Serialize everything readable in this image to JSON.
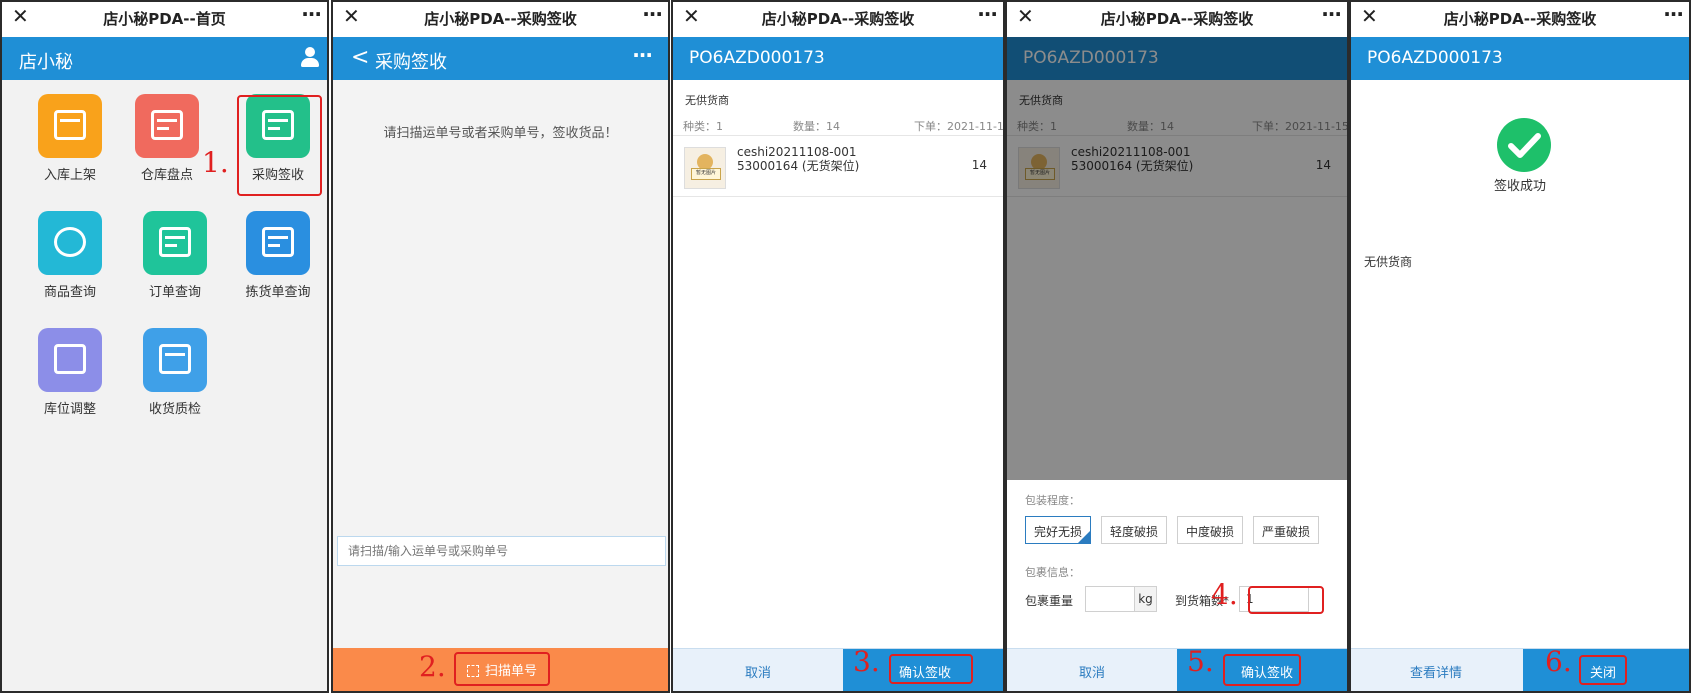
{
  "colors": {
    "brand_blue": "#1f8fd6",
    "annotation_red": "#e02020",
    "scan_orange": "#fa8a4a",
    "success_green": "#1ec06a"
  },
  "window": {
    "close_glyph": "✕",
    "more_glyph": "···"
  },
  "panel1": {
    "title": "店小秘PDA--首页",
    "header": "店小秘",
    "tiles": [
      {
        "label": "入库上架",
        "icon": "shelf-upload-icon",
        "color": "#f9a21b"
      },
      {
        "label": "仓库盘点",
        "icon": "inventory-calculator-icon",
        "color": "#f06a5e"
      },
      {
        "label": "采购签收",
        "icon": "purchase-receive-icon",
        "color": "#23c08a"
      },
      {
        "label": "商品查询",
        "icon": "product-search-icon",
        "color": "#23b8d6"
      },
      {
        "label": "订单查询",
        "icon": "order-query-icon",
        "color": "#1fc49a"
      },
      {
        "label": "拣货单查询",
        "icon": "pick-list-icon",
        "color": "#2a8fe0"
      },
      {
        "label": "库位调整",
        "icon": "location-adjust-icon",
        "color": "#8c8ee8"
      },
      {
        "label": "收货质检",
        "icon": "quality-check-icon",
        "color": "#3fa0e8"
      }
    ],
    "step_mark": "1."
  },
  "panel2": {
    "title": "店小秘PDA--采购签收",
    "header": "采购签收",
    "back_glyph": "<",
    "more_glyph": "···",
    "hint": "请扫描运单号或者采购单号，签收货品！",
    "input_placeholder": "请扫描/输入运单号或采购单号",
    "scan_button": "扫描单号",
    "step_mark": "2."
  },
  "order": {
    "id": "PO6AZD000173",
    "supplier": "无供货商",
    "kinds_label": "种类：1",
    "qty_label": "数量：14",
    "date_label": "下单：2021-11-15",
    "item_name": "ceshi20211108-001",
    "item_sub": "53000164 (无货架位)",
    "item_qty": "14",
    "thumb_text": "暂无图片"
  },
  "panel3": {
    "title": "店小秘PDA--采购签收",
    "cancel": "取消",
    "confirm": "确认签收",
    "step_mark": "3."
  },
  "panel4": {
    "title": "店小秘PDA--采购签收",
    "pack_label": "包装程度：",
    "options": [
      "完好无损",
      "轻度破损",
      "中度破损",
      "严重破损"
    ],
    "info_label": "包裹信息：",
    "weight_label": "包裹重量",
    "weight_unit": "kg",
    "arrive_label": "到货箱数*",
    "arrive_value": "1",
    "cancel": "取消",
    "confirm": "确认签收",
    "step_mark_a": "4.",
    "step_mark_b": "5."
  },
  "panel5": {
    "title": "店小秘PDA--采购签收",
    "success": "签收成功",
    "supplier": "无供货商",
    "details": "查看详情",
    "close": "关闭",
    "step_mark": "6."
  }
}
